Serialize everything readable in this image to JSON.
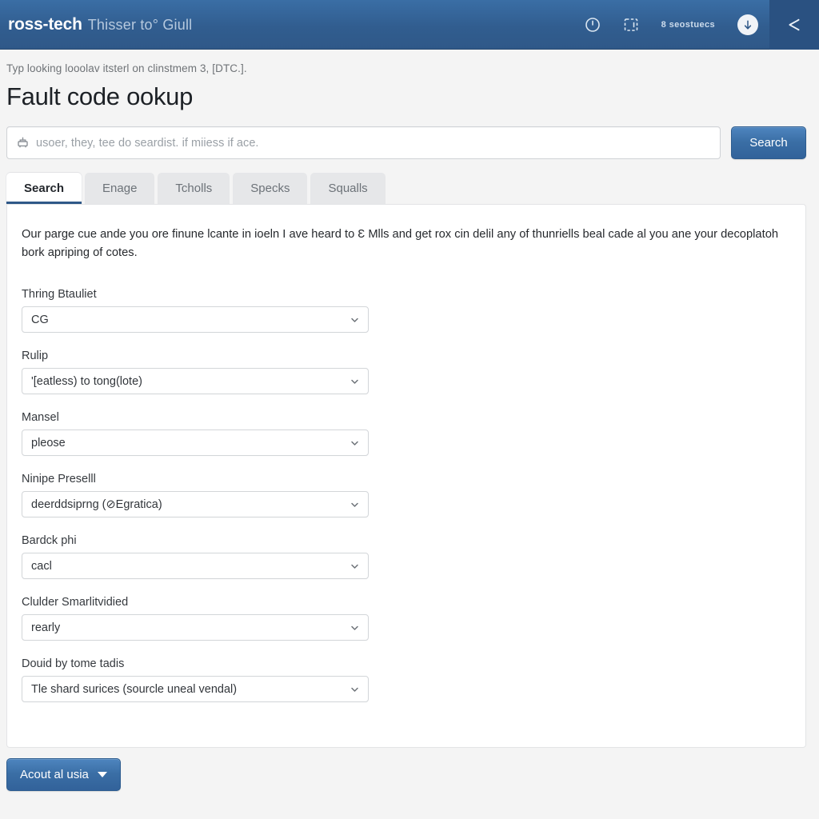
{
  "topbar": {
    "brand": "ross-tech",
    "subtitle": "Thisser to° Giull",
    "accent_color": "#3a6ea5",
    "tools": {
      "clock_icon": "clock-icon",
      "scan_icon": "scan-frame-icon",
      "counter_text": "8 seostuecs",
      "add_icon": "add-circle-icon",
      "share_icon": "share-icon"
    }
  },
  "breadcrumb": "Typ looking looolav itsterl on clinstmem 3, [DTC.].",
  "page_title": "Fault code ookup",
  "search": {
    "icon": "vehicle-icon",
    "placeholder": "usoer, they, tee do seardist. if miiess if ace.",
    "value": "",
    "button_label": "Search"
  },
  "tabs": [
    {
      "label": "Search",
      "active": true
    },
    {
      "label": "Enage",
      "active": false
    },
    {
      "label": "Tcholls",
      "active": false
    },
    {
      "label": "Specks",
      "active": false
    },
    {
      "label": "Squalls",
      "active": false
    }
  ],
  "panel": {
    "intro": "Our parge cue ande you ore finune lcante in ioeln I ave heard to Ɛ Mlls and get rox cin delil any of thunriells beal cade al you ane your decoplatoh bork apriping of cotes.",
    "fields": [
      {
        "label": "Thring Btauliet",
        "value": "CG"
      },
      {
        "label": "Rulip",
        "value": "'[eatless) to tong(lote)"
      },
      {
        "label": "Mansel",
        "value": "pleose"
      },
      {
        "label": "Ninipe Preselll",
        "value": "deerddsiprng (⊘Egratica)"
      },
      {
        "label": "Bardck phi",
        "value": "cacl"
      },
      {
        "label": "Clulder Smarlitvidied",
        "value": "rearly"
      },
      {
        "label": "Douid by tome tadis",
        "value": "Tle shard surices (sourcle uneal vendal)"
      }
    ]
  },
  "footer": {
    "action_label": "Acout al usia",
    "caret_icon": "caret-down-icon"
  }
}
